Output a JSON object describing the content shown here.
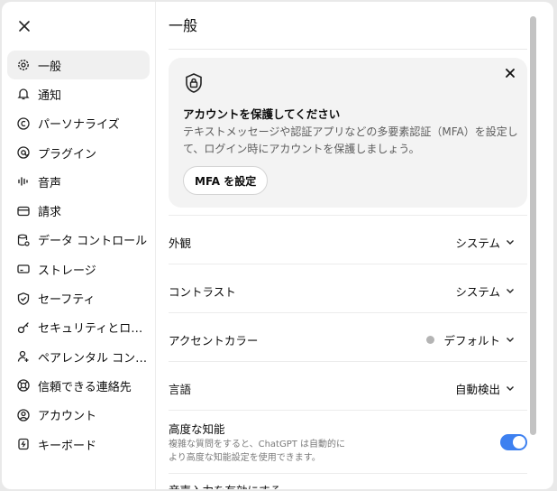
{
  "sidebar": {
    "items": [
      {
        "label": "一般",
        "icon": "gear-icon"
      },
      {
        "label": "通知",
        "icon": "bell-icon"
      },
      {
        "label": "パーソナライズ",
        "icon": "personalize-icon"
      },
      {
        "label": "プラグイン",
        "icon": "plugin-icon"
      },
      {
        "label": "音声",
        "icon": "audio-wave-icon"
      },
      {
        "label": "請求",
        "icon": "card-icon"
      },
      {
        "label": "データ コントロール",
        "icon": "database-icon"
      },
      {
        "label": "ストレージ",
        "icon": "storage-icon"
      },
      {
        "label": "セーフティ",
        "icon": "shield-icon"
      },
      {
        "label": "セキュリティとログイン",
        "icon": "key-icon"
      },
      {
        "label": "ペアレンタル コントロール",
        "icon": "parent-icon"
      },
      {
        "label": "信頼できる連絡先",
        "icon": "lifebuoy-icon"
      },
      {
        "label": "アカウント",
        "icon": "user-circle-icon"
      },
      {
        "label": "キーボード",
        "icon": "keyboard-icon"
      }
    ]
  },
  "main": {
    "title": "一般",
    "mfa": {
      "title": "アカウントを保護してください",
      "description": "テキストメッセージや認証アプリなどの多要素認証（MFA）を設定して、ログイン時にアカウントを保護しましょう。",
      "button": "MFA を設定"
    },
    "settings": {
      "appearance": {
        "label": "外観",
        "value": "システム"
      },
      "contrast": {
        "label": "コントラスト",
        "value": "システム"
      },
      "accent": {
        "label": "アクセントカラー",
        "value": "デフォルト"
      },
      "language": {
        "label": "言語",
        "value": "自動検出"
      },
      "intelligence": {
        "label": "高度な知能",
        "description": "複雑な質問をすると、ChatGPT は自動的により高度な知能設定を使用できます。",
        "enabled": true
      },
      "voice_input": {
        "label": "音声入力を有効にする"
      }
    }
  },
  "colors": {
    "toggle_on": "#3d80f0",
    "accent_dot": "#b4b4b4"
  }
}
